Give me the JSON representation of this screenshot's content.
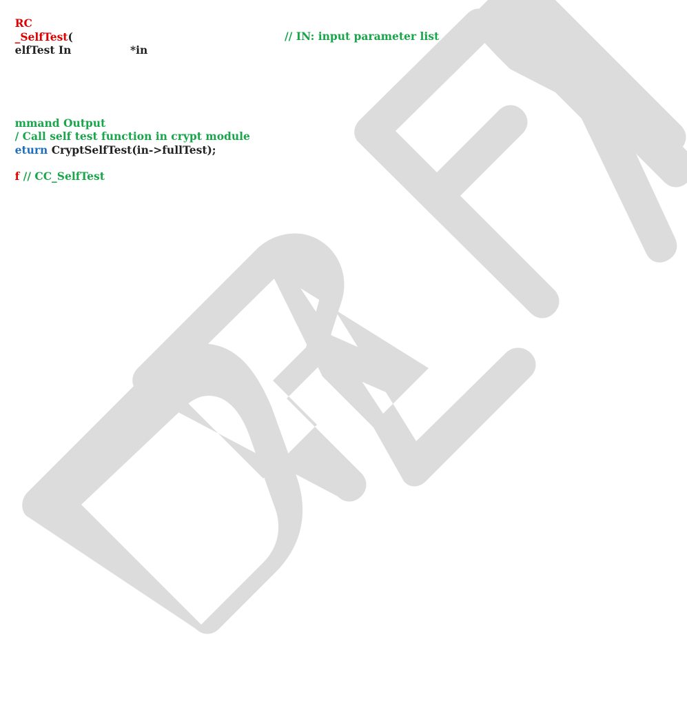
{
  "code": {
    "line1": {
      "type": "RC"
    },
    "line2": {
      "function_name": "SelfTest",
      "open_paren": "("
    },
    "line3": {
      "param_type": "elfTest In",
      "param_name": "*in",
      "comment": "// IN: input parameter list"
    },
    "line4": {
      "marker": "_"
    },
    "line5": {
      "comment": "mmand Output"
    },
    "line6": {
      "comment": "/ Call self test function in crypt module"
    },
    "line7": {
      "keyword": "eturn",
      "call": " CryptSelfTest(in->fullTest);"
    },
    "line8": {
      "directive": "f",
      "comment": " // CC_SelfTest"
    }
  },
  "watermark": {
    "text": "DRAFT",
    "color": "#dcdcdc"
  },
  "colors": {
    "type_red": "#e00000",
    "comment_green": "#19a64b",
    "keyword_blue": "#1f6fbf",
    "text_dark": "#222222"
  }
}
